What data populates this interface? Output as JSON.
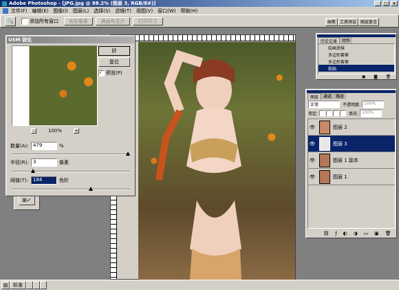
{
  "window": {
    "title": "Adobe Photoshop - [JPG.jpg @ 88.2% (图层 3, RGB/8#)]"
  },
  "menu": [
    "文件(F)",
    "编辑(E)",
    "图像(I)",
    "图层(L)",
    "选择(S)",
    "滤镜(T)",
    "视图(V)",
    "窗口(W)",
    "帮助(H)"
  ],
  "options_bar": {
    "checkbox_label": "添加所有窗口",
    "buttons": [
      "实际像素",
      "满画布显示",
      "打印尺寸"
    ],
    "palette_tabs": [
      "画笔",
      "工具预设",
      "图层复合"
    ]
  },
  "usm": {
    "title": "USM 锐化",
    "ok": "好",
    "reset": "复位",
    "preview": "预览(P)",
    "zoom": "100%",
    "amount_label": "数量(A):",
    "amount_value": "479",
    "amount_unit": "%",
    "radius_label": "半径(R):",
    "radius_value": "3",
    "radius_unit": "像素",
    "threshold_label": "阈值(T):",
    "threshold_value": "184",
    "threshold_unit": "色阶"
  },
  "history": {
    "tabs": [
      "历史记录",
      "动作"
    ],
    "items": [
      "绘画涂抹",
      "多边形套索",
      "多边形套索",
      "粘贴"
    ]
  },
  "layers": {
    "tabs": [
      "图层",
      "通道",
      "路径"
    ],
    "blend_mode": "正常",
    "opacity_label": "不透明度:",
    "opacity_value": "100%",
    "lock_label": "锁定:",
    "fill_label": "填充:",
    "fill_value": "100%",
    "items": [
      "图层 2",
      "图层 3",
      "图层 1 副本",
      "图层 1"
    ]
  },
  "taskbar": {
    "label": "标准"
  },
  "colors": {
    "title": "#0a246a",
    "face": "#d4d0c8",
    "desktop": "#3a6ea5"
  }
}
